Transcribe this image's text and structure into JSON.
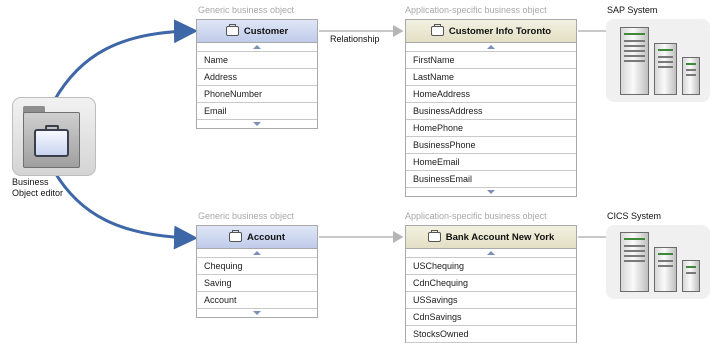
{
  "editor": {
    "label_line1": "Business",
    "label_line2": "Object editor",
    "icon": "briefcase-icon"
  },
  "top": {
    "generic_caption": "Generic business object",
    "app_caption": "Application-specific business object",
    "relationship_label": "Relationship",
    "generic": {
      "title": "Customer",
      "attributes": [
        "Name",
        "Address",
        "PhoneNumber",
        "Email"
      ]
    },
    "app": {
      "title": "Customer Info Toronto",
      "attributes": [
        "FirstName",
        "LastName",
        "HomeAddress",
        "BusinessAddress",
        "HomePhone",
        "BusinessPhone",
        "HomeEmail",
        "BusinessEmail"
      ]
    },
    "system_label": "SAP System"
  },
  "bottom": {
    "generic_caption": "Generic business object",
    "app_caption": "Application-specific business object",
    "generic": {
      "title": "Account",
      "attributes": [
        "Chequing",
        "Saving",
        "Account"
      ]
    },
    "app": {
      "title": "Bank Account New York",
      "attributes": [
        "USChequing",
        "CdnChequing",
        "USSavings",
        "CdnSavings",
        "StocksOwned"
      ]
    },
    "system_label": "CICS System"
  },
  "colors": {
    "generic_header": "#c6d0ee",
    "app_header": "#e8e4cc",
    "arrow": "#3e67a8",
    "connector": "#b5b5b5"
  }
}
